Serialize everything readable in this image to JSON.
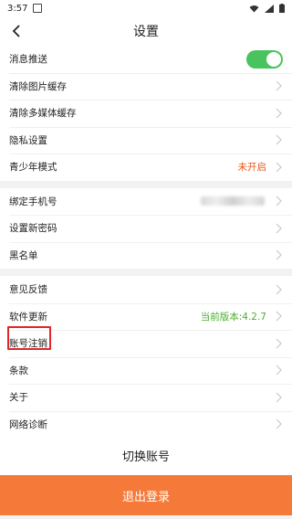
{
  "status_bar": {
    "time": "3:57"
  },
  "header": {
    "title": "设置"
  },
  "groups": {
    "g1": [
      {
        "label": "消息推送",
        "toggle_on": true
      },
      {
        "label": "清除图片缓存"
      },
      {
        "label": "清除多媒体缓存"
      },
      {
        "label": "隐私设置"
      },
      {
        "label": "青少年模式",
        "value": "未开启",
        "value_color": "#e55a1b"
      }
    ],
    "g2": [
      {
        "label": "绑定手机号",
        "value_masked": true
      },
      {
        "label": "设置新密码"
      },
      {
        "label": "黑名单"
      }
    ],
    "g3": [
      {
        "label": "意见反馈"
      },
      {
        "label": "软件更新",
        "value": "当前版本:4.2.7",
        "value_color": "#4cae2e"
      },
      {
        "label": "账号注销",
        "highlighted": true
      },
      {
        "label": "条款"
      },
      {
        "label": "关于"
      },
      {
        "label": "网络诊断"
      }
    ]
  },
  "buttons": {
    "switch_account": "切换账号",
    "logout": "退出登录"
  },
  "colors": {
    "toggle_on": "#49c35d",
    "logout_bg": "#f57a3a",
    "highlight_border": "#e0262a"
  }
}
